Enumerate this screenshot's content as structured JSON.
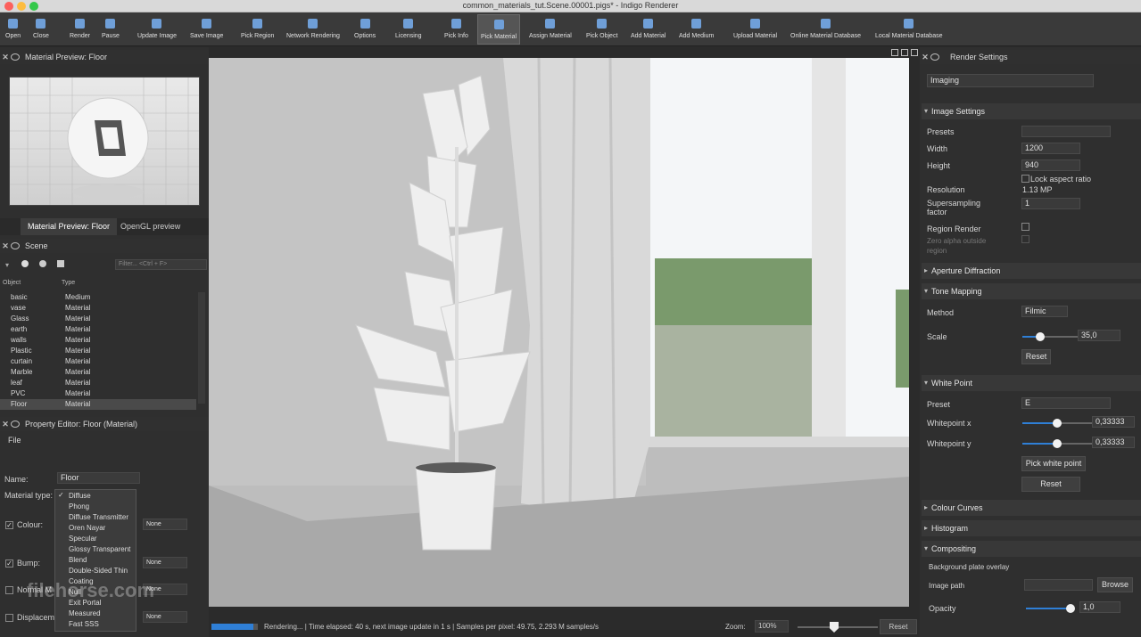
{
  "window": {
    "title": "common_materials_tut.Scene.00001.pigs* - Indigo Renderer"
  },
  "toolbar": [
    {
      "label": "Open",
      "icon": "open-icon"
    },
    {
      "label": "Close",
      "icon": "close-icon"
    },
    {
      "label": "Render",
      "icon": "render-icon"
    },
    {
      "label": "Pause",
      "icon": "pause-icon"
    },
    {
      "label": "Update Image",
      "icon": "update-icon"
    },
    {
      "label": "Save Image",
      "icon": "save-icon"
    },
    {
      "label": "Pick Region",
      "icon": "region-icon"
    },
    {
      "label": "Network Rendering",
      "icon": "network-icon"
    },
    {
      "label": "Options",
      "icon": "gear-icon"
    },
    {
      "label": "Licensing",
      "icon": "key-icon"
    },
    {
      "label": "Pick Info",
      "icon": "info-icon"
    },
    {
      "label": "Pick Material",
      "icon": "pick-material-icon"
    },
    {
      "label": "Assign Material",
      "icon": "assign-icon"
    },
    {
      "label": "Pick Object",
      "icon": "pick-object-icon"
    },
    {
      "label": "Add Material",
      "icon": "add-material-icon"
    },
    {
      "label": "Add Medium",
      "icon": "add-medium-icon"
    },
    {
      "label": "Upload Material",
      "icon": "upload-icon"
    },
    {
      "label": "Online Material Database",
      "icon": "online-db-icon"
    },
    {
      "label": "Local Material Database",
      "icon": "local-db-icon"
    }
  ],
  "material_preview": {
    "header": "Material Preview: Floor",
    "tabs": [
      "Material Preview: Floor",
      "OpenGL preview"
    ]
  },
  "scene": {
    "header": "Scene",
    "filter_placeholder": "Filter... <Ctrl + F>",
    "columns": [
      "Object",
      "Type"
    ],
    "rows": [
      {
        "name": "basic",
        "type": "Medium"
      },
      {
        "name": "vase",
        "type": "Material"
      },
      {
        "name": "Glass",
        "type": "Material"
      },
      {
        "name": "earth",
        "type": "Material"
      },
      {
        "name": "walls",
        "type": "Material"
      },
      {
        "name": "Plastic",
        "type": "Material"
      },
      {
        "name": "curtain",
        "type": "Material"
      },
      {
        "name": "Marble",
        "type": "Material"
      },
      {
        "name": "leaf",
        "type": "Material"
      },
      {
        "name": "PVC",
        "type": "Material"
      },
      {
        "name": "Floor",
        "type": "Material"
      }
    ]
  },
  "property_editor": {
    "header": "Property Editor: Floor (Material)",
    "menu": "File",
    "name_label": "Name:",
    "name_value": "Floor",
    "type_label": "Material type:",
    "colour_label": "Colour:",
    "bump_label": "Bump:",
    "normal_label": "Normal M",
    "displace_label": "Displacem",
    "none": "None",
    "type_options": [
      "Diffuse",
      "Phong",
      "Diffuse Transmitter",
      "Oren Nayar",
      "Specular",
      "Glossy Transparent",
      "Blend",
      "Double-Sided Thin",
      "Coating",
      "Null",
      "Exit Portal",
      "Measured",
      "Fast SSS"
    ]
  },
  "status": {
    "text": "Rendering... | Time elapsed: 40 s, next image update in 1 s | Samples per pixel: 49.75, 2.293 M samples/s",
    "progress": 0.9,
    "zoom_label": "Zoom:",
    "zoom_value": "100%",
    "reset": "Reset"
  },
  "render_settings": {
    "header": "Render Settings",
    "mode": "Imaging",
    "image_settings": "Image Settings",
    "presets": "Presets",
    "width_label": "Width",
    "width": "1200",
    "height_label": "Height",
    "height": "940",
    "lock_aspect": "Lock aspect ratio",
    "resolution_label": "Resolution",
    "resolution": "1.13 MP",
    "supersampling_label": "Supersampling",
    "factor_label": "factor",
    "supersampling": "1",
    "region_render": "Region Render",
    "zero_alpha_1": "Zero alpha outside",
    "zero_alpha_2": "region",
    "aperture": "Aperture Diffraction",
    "tone_mapping": "Tone Mapping",
    "method_label": "Method",
    "method": "Filmic",
    "scale_label": "Scale",
    "scale": "35,0",
    "scale_fraction": 0.25,
    "reset": "Reset",
    "white_point": "White Point",
    "preset_label": "Preset",
    "preset": "E",
    "wpx_label": "Whitepoint x",
    "wpx": "0,33333",
    "wpx_fraction": 0.5,
    "wpy_label": "Whitepoint y",
    "wpy": "0,33333",
    "wpy_fraction": 0.5,
    "pick_white": "Pick white point",
    "colour_curves": "Colour Curves",
    "histogram": "Histogram",
    "compositing": "Compositing",
    "bg_overlay": "Background plate overlay",
    "image_path": "Image path",
    "browse": "Browse",
    "opacity_label": "Opacity",
    "opacity": "1,0",
    "opacity_fraction": 1.0
  },
  "watermark": "filehorse.com",
  "colors": {
    "accent": "#2f7fd6",
    "panel": "#2f2f2f",
    "toolbar": "#3a3a3a"
  }
}
